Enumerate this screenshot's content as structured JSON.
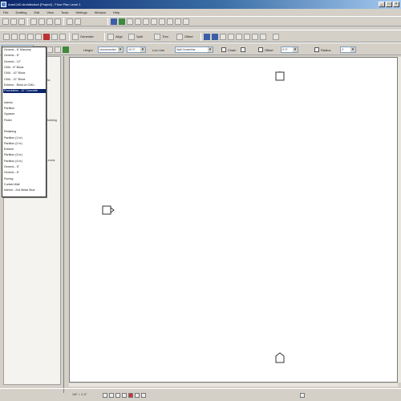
{
  "title": "AutoCAD Architecture [Project] - Floor Plan Level 1",
  "menu": [
    "File",
    "Drafting",
    "Edit",
    "View",
    "Tools",
    "Settings",
    "Window",
    "Help"
  ],
  "toolbar2": {
    "generate_label": "Generate",
    "align_label": "Align",
    "split_label": "Split",
    "trim_label": "Trim",
    "offset_label": "Offset"
  },
  "toolbar3": {
    "height_label": "Height",
    "height_value": "Unconnected",
    "height_num": "10' 0\"",
    "location_label": "Loc Line",
    "location_value": "Wall Centerline",
    "chain_label": "Chain",
    "offset_label": "Offset",
    "offset_value": "0' 0\"",
    "radius_label": "Radius",
    "radius_value": "0'"
  },
  "dropdown": {
    "items": [
      "Generic - 6\" Masonry",
      "Generic - 8\"",
      "Generic - 12\"",
      "CMU - 8\" Block",
      "CMU - 10\" Block",
      "CMU - 12\" Block",
      "Exterior - Brick on CMU",
      "Foundation - 12\" Concrete",
      "",
      "Interior",
      "Partition",
      "Gypsum",
      "Finish",
      "",
      "Retaining",
      "Partition (1 hr)",
      "Partition (2 hr)",
      "Exterior",
      "Partition (3 hr)",
      "Partition (4 hr)",
      "Generic - 5\"",
      "Generic - 6\"",
      "Furring",
      "Curtain Wall",
      "Interior - 2x4 Metal Stud"
    ],
    "selected_index": 7
  },
  "sidebar": {
    "labels": [
      "Ba",
      "Building",
      "Levels"
    ]
  },
  "status": {
    "coords": "1/8\" = 1'-0\""
  }
}
